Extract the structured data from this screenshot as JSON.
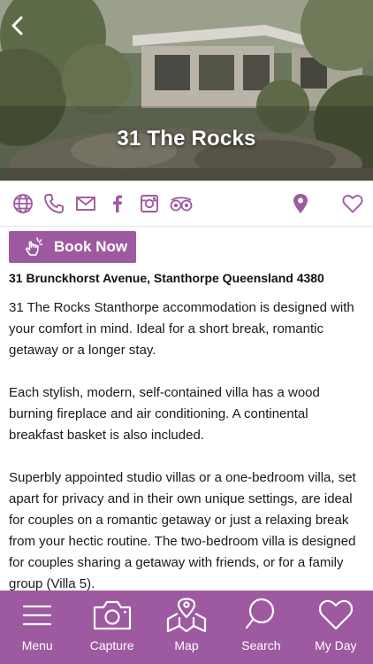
{
  "header": {
    "title": "31 The Rocks"
  },
  "contact_icons": [
    "globe-icon",
    "phone-icon",
    "email-icon",
    "facebook-icon",
    "instagram-icon",
    "tripadvisor-icon",
    "map-pin-icon",
    "heart-icon"
  ],
  "book": {
    "label": "Book Now"
  },
  "address": "31 Brunckhorst Avenue, Stanthorpe Queensland 4380",
  "description": [
    "31 The Rocks Stanthorpe accommodation is designed with your comfort in mind. Ideal for a short break, romantic getaway or a longer stay.",
    "Each stylish, modern, self-contained villa has a wood burning fireplace and air conditioning. A continental breakfast basket is also included.",
    "Superbly appointed studio villas or a one-bedroom villa, set apart for privacy and in their own unique settings, are ideal for couples on a romantic getaway or just a relaxing break from your hectic routine. The two-bedroom villa is designed for couples sharing a getaway with friends, or for a family group (Villa 5)."
  ],
  "tabbar": {
    "items": [
      {
        "label": "Menu",
        "icon": "menu-icon"
      },
      {
        "label": "Capture",
        "icon": "camera-icon"
      },
      {
        "label": "Map",
        "icon": "map-icon"
      },
      {
        "label": "Search",
        "icon": "search-icon"
      },
      {
        "label": "My Day",
        "icon": "heart-icon"
      }
    ]
  },
  "colors": {
    "accent": "#9e5aa0",
    "text": "#1a1a1a",
    "white": "#ffffff"
  }
}
